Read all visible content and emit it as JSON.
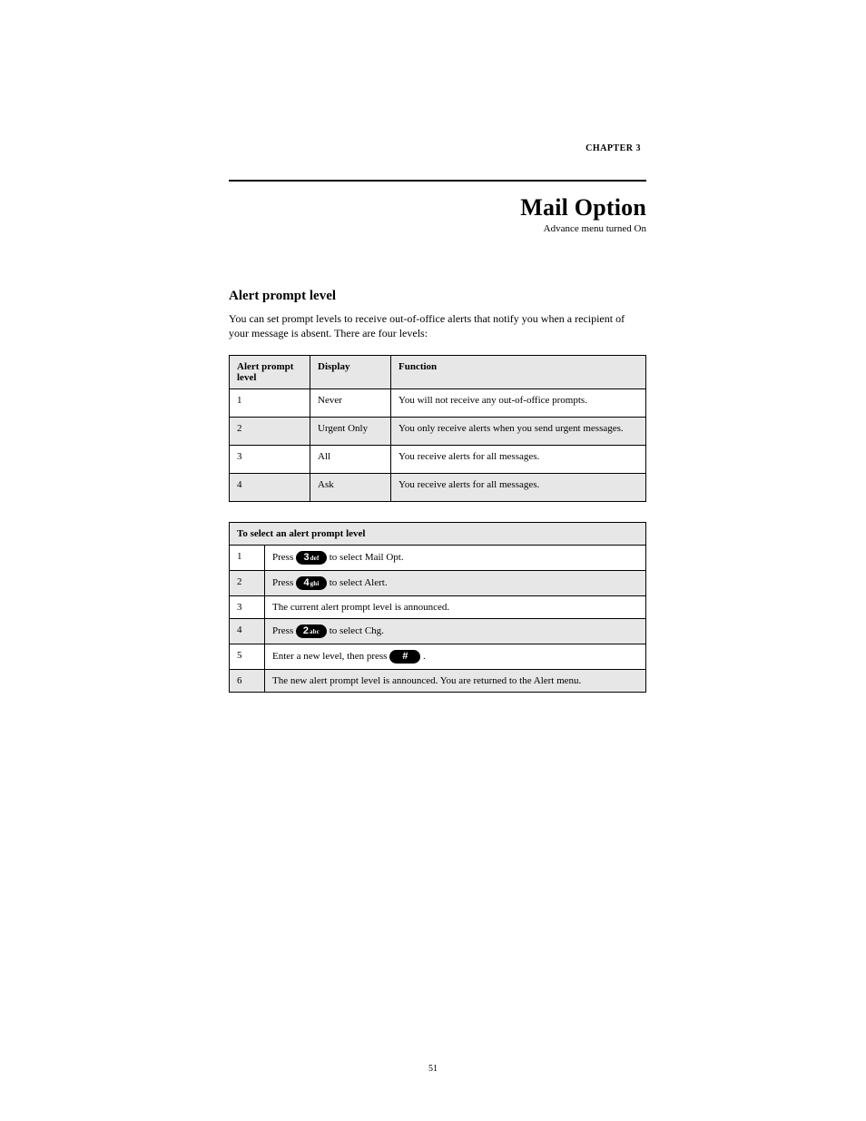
{
  "chapter_label": "CHAPTER 3",
  "title": "Mail Option",
  "subtitle": "Advance menu turned On",
  "section_head": "Alert prompt level",
  "intro": "You can set prompt levels to receive out-of-office alerts that notify you when a recipient of your message is absent. There are four levels:",
  "functions": {
    "headers": [
      "Alert prompt level",
      "Display",
      "Function"
    ],
    "rows": [
      {
        "level": "1",
        "display": "Never",
        "fn": "You will not receive any out-of-office prompts."
      },
      {
        "level": "2",
        "display": "Urgent Only",
        "fn": "You only receive alerts when you send urgent messages."
      },
      {
        "level": "3",
        "display": "All",
        "fn": "You receive alerts for all messages."
      },
      {
        "level": "4",
        "display": "Ask",
        "fn": "You receive alerts for all messages."
      }
    ]
  },
  "procedure_title": "To select an alert prompt level",
  "steps": [
    {
      "n": "1",
      "before": "Press ",
      "key": {
        "big": "3",
        "small": "def"
      },
      "after": " to select Mail Opt."
    },
    {
      "n": "2",
      "before": "Press ",
      "key": {
        "big": "4",
        "small": "ghi"
      },
      "after": " to select Alert."
    },
    {
      "n": "3",
      "text": "The current alert prompt level is announced."
    },
    {
      "n": "4",
      "before": "Press ",
      "key": {
        "big": "2",
        "small": "abc"
      },
      "after": " to select Chg."
    },
    {
      "n": "5",
      "before": "Enter a new level, then press ",
      "key": {
        "big": "#",
        "small": ""
      },
      "after": "."
    },
    {
      "n": "6",
      "text": "The new alert prompt level is announced. You are returned to the Alert menu."
    }
  ],
  "page_number": "51"
}
